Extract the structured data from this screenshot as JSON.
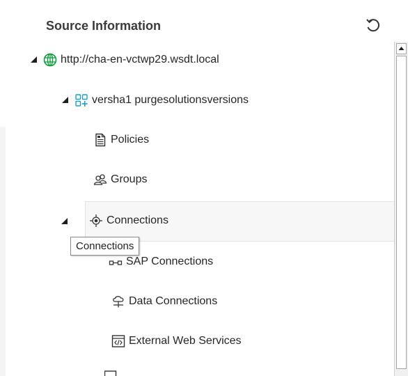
{
  "panel": {
    "title": "Source Information",
    "refresh_icon": "refresh-icon"
  },
  "tree": {
    "root": {
      "label": "http://cha-en-vctwp29.wsdt.local",
      "icon": "globe-icon",
      "expanded": true
    },
    "site": {
      "label": "versha1 purgesolutionsversions",
      "icon": "site-collection-icon",
      "expanded": true
    },
    "policies": {
      "label": "Policies",
      "icon": "policy-document-icon"
    },
    "groups": {
      "label": "Groups",
      "icon": "groups-icon"
    },
    "connections": {
      "label": "Connections",
      "icon": "connections-icon",
      "expanded": true,
      "selected": true
    },
    "sap_connections": {
      "label": "SAP Connections",
      "icon": "sap-connection-icon"
    },
    "data_connections": {
      "label": "Data Connections",
      "icon": "data-connection-icon"
    },
    "external_web_services": {
      "label": "External Web Services",
      "icon": "web-service-icon"
    }
  },
  "tooltip": {
    "text": "Connections"
  },
  "colors": {
    "accent": "#1ba1c5",
    "globe": "#0a9c3c",
    "selection_bg": "#f7f7f7"
  }
}
